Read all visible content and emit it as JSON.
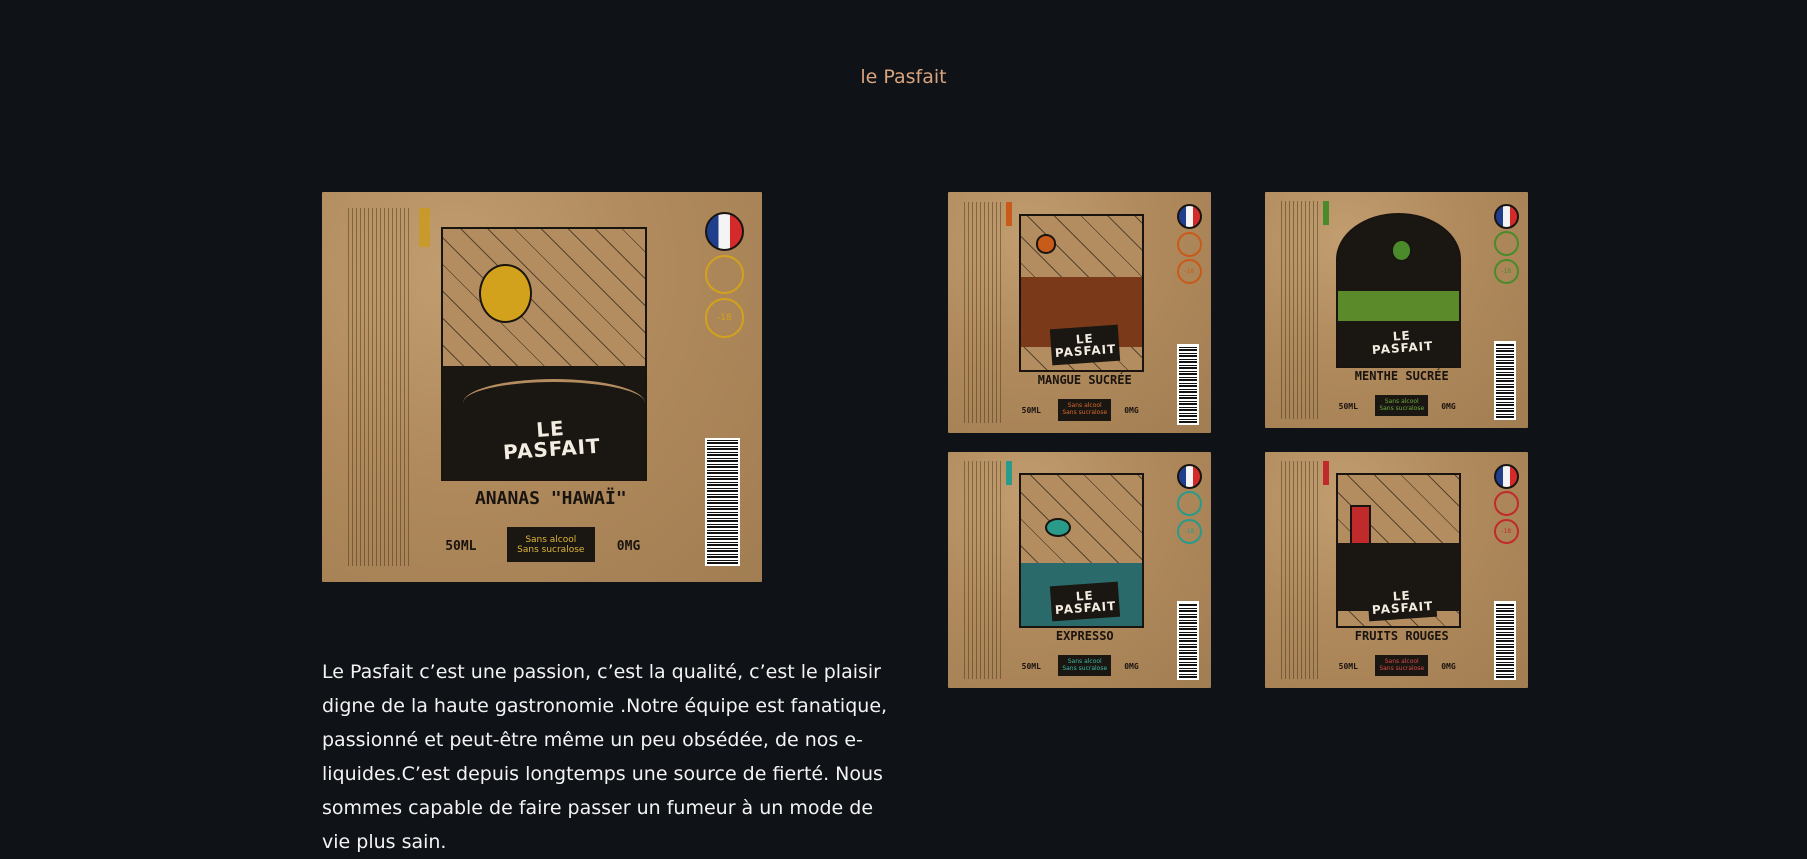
{
  "section_title": "le Pasfait",
  "main_label": {
    "brand": "LE PASFAIT",
    "product": "ANANAS \"HAWAÏ\"",
    "volume": "50ML",
    "nicotine": "0MG",
    "pill_line1": "Sans alcool",
    "pill_line2": "Sans sucralose",
    "age": "-18"
  },
  "small_labels": [
    {
      "brand": "LE PASFAIT",
      "product": "MANGUE SUCRÉE",
      "volume": "50ML",
      "nicotine": "0MG",
      "pill_line1": "Sans alcool",
      "pill_line2": "Sans sucralose",
      "age": "-18"
    },
    {
      "brand": "LE PASFAIT",
      "product": "MENTHE SUCRÉE",
      "volume": "50ML",
      "nicotine": "0MG",
      "pill_line1": "Sans alcool",
      "pill_line2": "Sans sucralose",
      "age": "-18"
    },
    {
      "brand": "LE PASFAIT",
      "product": "EXPRESSO",
      "volume": "50ML",
      "nicotine": "0MG",
      "pill_line1": "Sans alcool",
      "pill_line2": "Sans sucralose",
      "age": "-18"
    },
    {
      "brand": "LE PASFAIT",
      "product": "FRUITS ROUGES",
      "volume": "50ML",
      "nicotine": "0MG",
      "pill_line1": "Sans alcool",
      "pill_line2": "Sans sucralose",
      "age": "-18"
    }
  ],
  "description": "Le Pasfait c’est une passion, c’est la qualité, c’est le plaisir digne de la haute gastronomie .Notre équipe est fanatique, passionné et peut-être même un peu obsédée, de nos e-liquides.C’est depuis longtemps une source de fierté. Nous sommes capable de faire passer un fumeur à un mode de vie plus sain.",
  "colors": {
    "background": "#0f1216",
    "title": "#d9a57f",
    "kraft": "#b48f61",
    "ananas_accent": "#d3a21c",
    "mangue_accent": "#c85a1a",
    "menthe_accent": "#4a8a2a",
    "expresso_accent": "#2a9a8a",
    "fruits_rouges_accent": "#c02a2a"
  }
}
